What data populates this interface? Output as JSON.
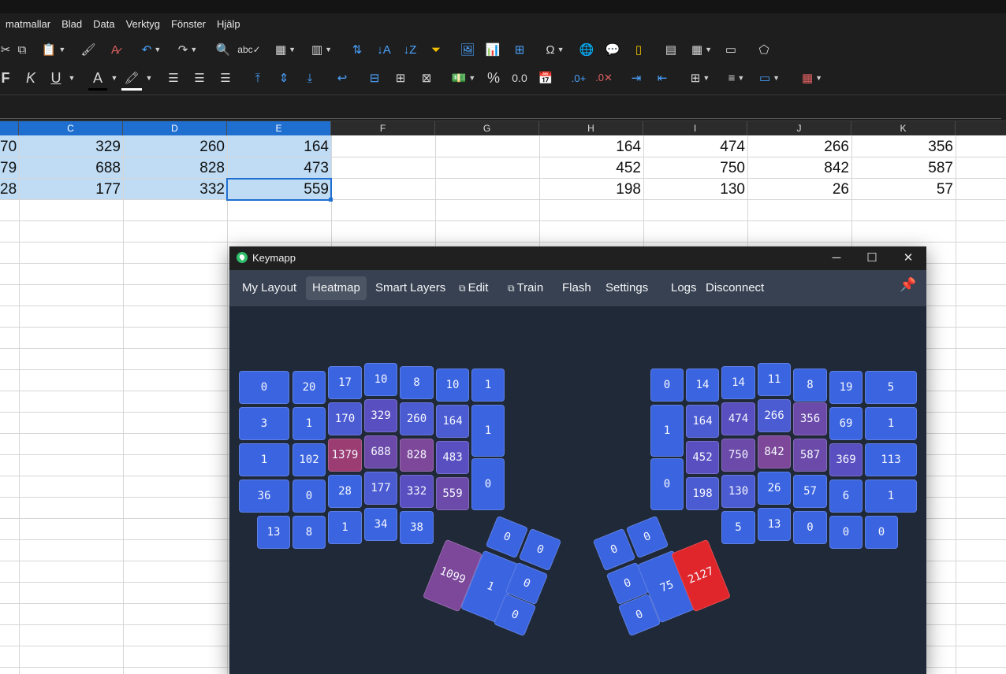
{
  "calc": {
    "menu": [
      "matmallar",
      "Blad",
      "Data",
      "Verktyg",
      "Fönster",
      "Hjälp"
    ],
    "format_buttons": {
      "bold": "F",
      "italic": "K",
      "underline": "U",
      "font_color": "A",
      "percent": "%",
      "number": "0.0"
    },
    "columns": [
      "C",
      "D",
      "E",
      "F",
      "G",
      "H",
      "I",
      "J",
      "K"
    ],
    "rows": [
      {
        "b": "70",
        "c": "329",
        "d": "260",
        "e": "164",
        "h": "164",
        "i": "474",
        "j": "266",
        "k": "356"
      },
      {
        "b": "79",
        "c": "688",
        "d": "828",
        "e": "473",
        "h": "452",
        "i": "750",
        "j": "842",
        "k": "587"
      },
      {
        "b": "28",
        "c": "177",
        "d": "332",
        "e": "559",
        "h": "198",
        "i": "130",
        "j": "26",
        "k": "57"
      }
    ]
  },
  "keymapp": {
    "title": "Keymapp",
    "nav": [
      "My Layout",
      "Heatmap",
      "Smart Layers",
      "Edit",
      "Train",
      "Flash",
      "Settings",
      "Logs",
      "Disconnect"
    ],
    "active_tab": "Heatmap",
    "heat_colors": [
      "#3b64e0",
      "#4b5bd2",
      "#5a4fc0",
      "#6b4aa9",
      "#7d4899",
      "#9b3d73",
      "#e0262b"
    ],
    "left_hand": {
      "row0": [
        "0",
        "20",
        "17",
        "10",
        "8",
        "10",
        "1"
      ],
      "row1": [
        "3",
        "1",
        "170",
        "329",
        "260",
        "164",
        "1"
      ],
      "row2": [
        "1",
        "102",
        "1379",
        "688",
        "828",
        "483",
        "0"
      ],
      "row3": [
        "36",
        "0",
        "28",
        "177",
        "332",
        "559"
      ],
      "row4": [
        "13",
        "8",
        "1",
        "34",
        "38"
      ],
      "thumb": [
        "1099",
        "1",
        "0",
        "0",
        "0",
        "0"
      ]
    },
    "right_hand": {
      "row0": [
        "0",
        "14",
        "14",
        "11",
        "8",
        "19",
        "5"
      ],
      "row1": [
        "1",
        "164",
        "474",
        "266",
        "356",
        "69",
        "1"
      ],
      "row2": [
        "0",
        "452",
        "750",
        "842",
        "587",
        "369",
        "113"
      ],
      "row3": [
        "198",
        "130",
        "26",
        "57",
        "6",
        "1"
      ],
      "row4": [
        "5",
        "13",
        "0",
        "0",
        "0"
      ],
      "thumb": [
        "0",
        "0",
        "0",
        "75",
        "2127",
        "0"
      ]
    }
  }
}
